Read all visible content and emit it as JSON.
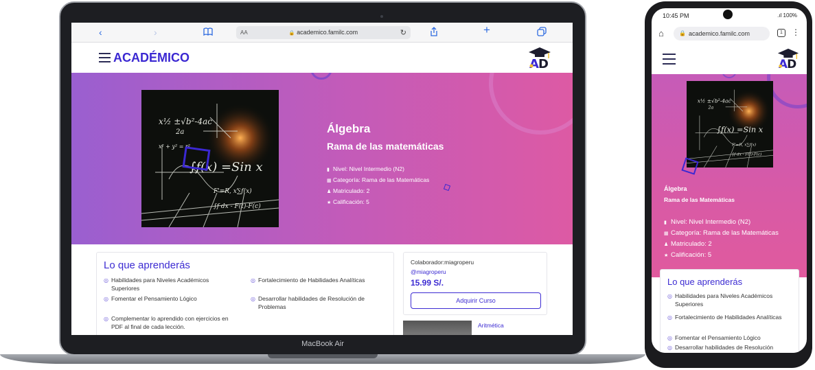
{
  "laptop": {
    "label": "MacBook Air",
    "browser": {
      "aa": "AA",
      "url": "academico.familc.com",
      "lock": "🔒",
      "reload": "↻",
      "back": "‹",
      "forward": "›",
      "book": "📖",
      "share": "⇪",
      "add": "+",
      "tabs": "⧉"
    },
    "site": {
      "brand": "ACADÉMICO",
      "course": {
        "title": "Álgebra",
        "subtitle": "Rama de las matemáticas",
        "meta": [
          {
            "icon": "signal-icon",
            "glyph": "▮",
            "text": "Nivel: Nivel Intermedio (N2)"
          },
          {
            "icon": "grid-icon",
            "glyph": "▦",
            "text": "Categoría: Rama de las Matemáticas"
          },
          {
            "icon": "user-plus-icon",
            "glyph": "♟",
            "text": "Matriculado: 2"
          },
          {
            "icon": "star-icon",
            "glyph": "★",
            "text": "Calificación: 5"
          }
        ]
      },
      "learn": {
        "title": "Lo que aprenderás",
        "items": [
          "Habilidades para Niveles Académicos Superiores",
          "Fortalecimiento de Habilidades Analíticas",
          "Fomentar el Pensamiento Lógico",
          "Desarrollar habilidades de Resolución de Problemas",
          "Complementar lo aprendido con ejercicios en PDF al final de cada lección."
        ]
      },
      "purchase": {
        "collaborator": "Colaborador:miagroperu",
        "handle": "@miagroperu",
        "price": "15.99 S/.",
        "button": "Adquirir Curso"
      },
      "related": {
        "name": "Aritmética"
      }
    }
  },
  "phone": {
    "status": {
      "time": "10:45 PM",
      "right": ".ıl 100%"
    },
    "url": "academico.familc.com",
    "tab_count": "1",
    "course": {
      "title": "Álgebra",
      "subtitle": "Rama de las Matemáticas",
      "meta": [
        {
          "icon": "signal-icon",
          "glyph": "▮",
          "text": "Nivel: Nivel Intermedio (N2)"
        },
        {
          "icon": "grid-icon",
          "glyph": "▦",
          "text": "Categoría: Rama de las Matemáticas"
        },
        {
          "icon": "user-plus-icon",
          "glyph": "♟",
          "text": "Matriculado: 2"
        },
        {
          "icon": "star-icon",
          "glyph": "★",
          "text": "Calificación: 5"
        }
      ]
    },
    "learn": {
      "title": "Lo que aprenderás",
      "items": [
        "Habilidades para Niveles Académicos Superiores",
        "Fortalecimiento de Habilidades Analíticas",
        "Fomentar el Pensamiento Lógico",
        "Desarrollar habilidades de Resolución"
      ]
    }
  }
}
